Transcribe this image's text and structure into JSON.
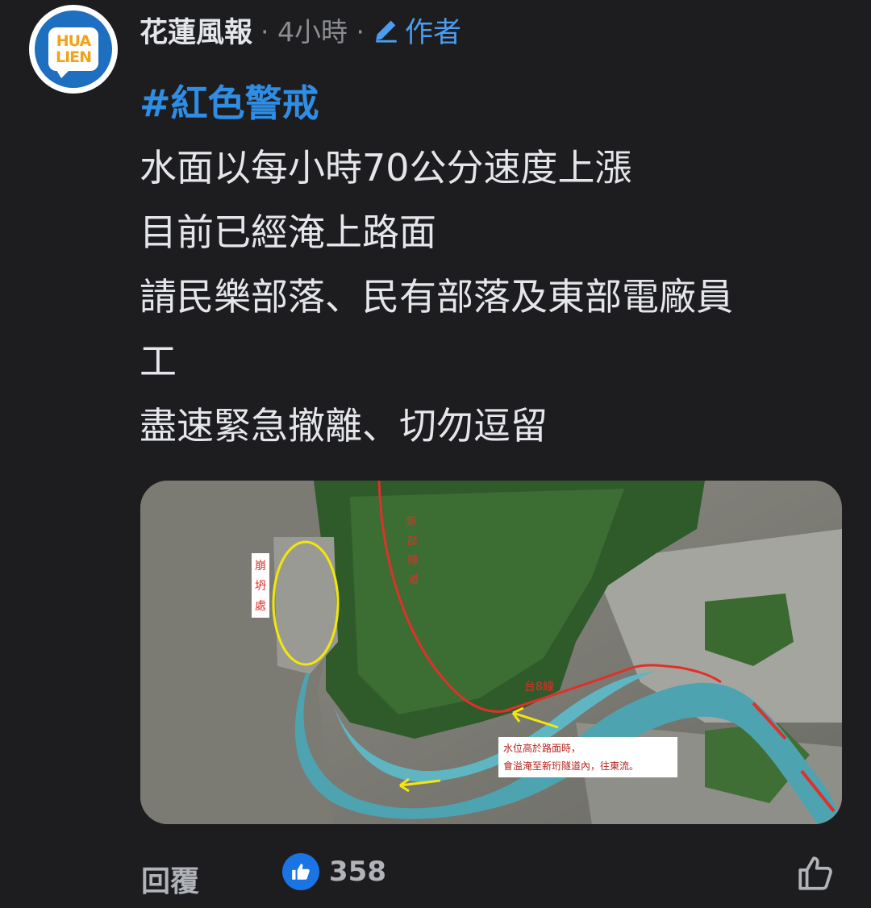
{
  "comment": {
    "avatar_logo_lines": [
      "HUA",
      "LIEN"
    ],
    "page_name": "花蓮風報",
    "time": "· 4小時 ·",
    "author_label": "作者",
    "hashtag": "#紅色警戒",
    "lines": [
      "水面以每小時70公分速度上漲",
      "目前已經淹上路面",
      "請民樂部落、民有部落及東部電廠員",
      "工",
      "盡速緊急撤離、切勿逗留"
    ]
  },
  "photo": {
    "label_collapse": [
      "崩",
      "坍",
      "處"
    ],
    "label_tunnel": [
      "新",
      "部",
      "隧",
      "道"
    ],
    "label_road": "台8線",
    "note_lines": [
      "水位高於路面時，",
      "會溢淹至新珩隧道內，往東流。"
    ]
  },
  "footer": {
    "reply_label": "回覆",
    "like_count": "358"
  },
  "colors": {
    "background": "#1d1d1f",
    "hashtag": "#2f8de4",
    "like_badge": "#1b74e4",
    "annotation_red": "#e0302a",
    "annotation_yellow": "#f2e60c"
  },
  "icons": [
    "pencil-icon",
    "like-reaction-icon",
    "thumbs-up-outline-icon"
  ]
}
